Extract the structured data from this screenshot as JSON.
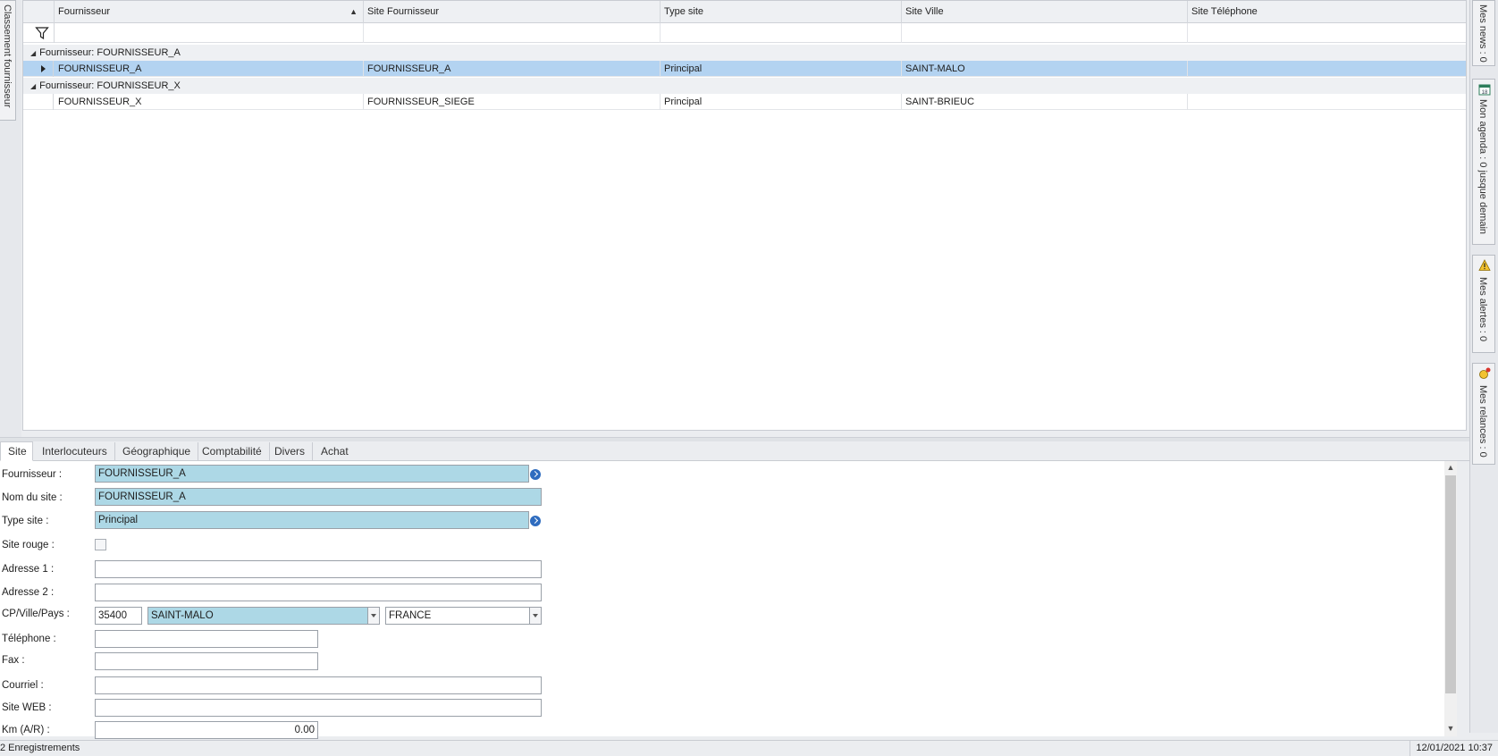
{
  "left_panel": {
    "tab_label": "Classement fournisseur"
  },
  "grid": {
    "columns": [
      "Fournisseur",
      "Site Fournisseur",
      "Type site",
      "Site Ville",
      "Site Téléphone"
    ],
    "groups": [
      {
        "label": "Fournisseur: FOURNISSEUR_A",
        "rows": [
          {
            "fournisseur": "FOURNISSEUR_A",
            "site_fournisseur": "FOURNISSEUR_A",
            "type_site": "Principal",
            "site_ville": "SAINT-MALO",
            "site_telephone": ""
          }
        ]
      },
      {
        "label": "Fournisseur: FOURNISSEUR_X",
        "rows": [
          {
            "fournisseur": "FOURNISSEUR_X",
            "site_fournisseur": "FOURNISSEUR_SIEGE",
            "type_site": "Principal",
            "site_ville": "SAINT-BRIEUC",
            "site_telephone": ""
          }
        ]
      }
    ]
  },
  "right_panel": {
    "tabs": [
      {
        "label": "Mes news : 0",
        "icon": "news-icon"
      },
      {
        "label": "Mon agenda : 0 jusque demain",
        "icon": "calendar-icon",
        "icon_text": "18"
      },
      {
        "label": "Mes alertes : 0",
        "icon": "warning-icon"
      },
      {
        "label": "Mes relances : 0",
        "icon": "reminder-icon"
      }
    ]
  },
  "detail_tabs": [
    "Site",
    "Interlocuteurs",
    "Géographique",
    "Comptabilité",
    "Divers",
    "Achat"
  ],
  "form": {
    "fournisseur": {
      "label": "Fournisseur :",
      "value": "FOURNISSEUR_A"
    },
    "nom_site": {
      "label": "Nom du site :",
      "value": "FOURNISSEUR_A"
    },
    "type_site": {
      "label": "Type site :",
      "value": "Principal"
    },
    "site_rouge": {
      "label": "Site rouge :",
      "checked": false
    },
    "adresse1": {
      "label": "Adresse 1 :",
      "value": ""
    },
    "adresse2": {
      "label": "Adresse 2 :",
      "value": ""
    },
    "cp_ville_pays": {
      "label": "CP/Ville/Pays :",
      "cp": "35400",
      "ville": "SAINT-MALO",
      "pays": "FRANCE"
    },
    "telephone": {
      "label": "Téléphone :",
      "value": ""
    },
    "fax": {
      "label": "Fax :",
      "value": ""
    },
    "courriel": {
      "label": "Courriel :",
      "value": ""
    },
    "site_web": {
      "label": "Site WEB :",
      "value": ""
    },
    "km": {
      "label": "Km (A/R) :",
      "value": "0.00"
    }
  },
  "status": {
    "records": "2 Enregistrements",
    "datetime": "12/01/2021 10:37"
  },
  "colors": {
    "selection": "#b3d3f1",
    "lookup_field": "#add8e6",
    "accent": "#2f6cbf"
  }
}
